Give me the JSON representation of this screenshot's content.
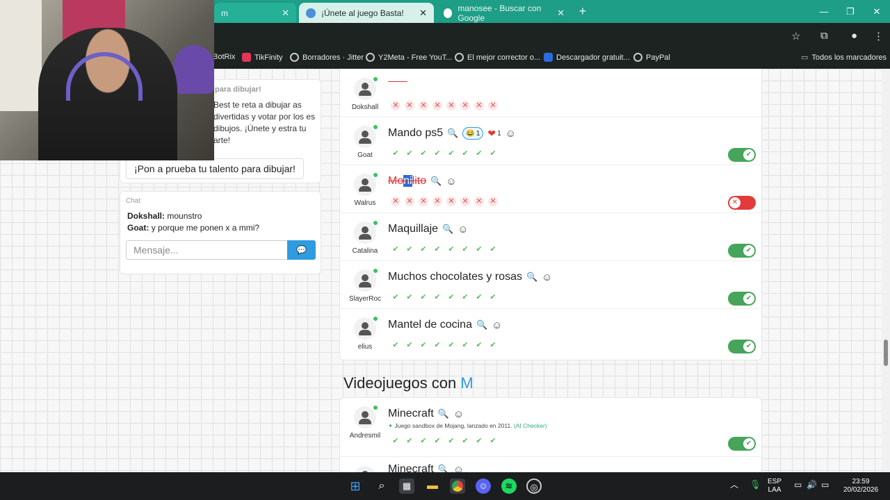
{
  "browser": {
    "tabs": [
      {
        "label": "m",
        "active": false
      },
      {
        "label": "¡Únete al juego Basta!",
        "active": true
      },
      {
        "label": "manosee - Buscar con Google",
        "active": false
      }
    ],
    "bookmarks": [
      "BotRix",
      "TikFinity",
      "Borradores · Jitter",
      "Y2Meta - Free YouT...",
      "El mejor corrector o...",
      "Descargador gratuit...",
      "PayPal"
    ],
    "all_bookmarks": "Todos los marcadores"
  },
  "left": {
    "card_title": "para dibujar!",
    "card_text": "Best te reta a dibujar as divertidas y votar por los es dibujos. ¡Únete y estra tu arte!",
    "card_button": "¡Pon a prueba tu talento para dibujar!",
    "chat_header": "Chat",
    "chat": [
      {
        "user": "Dokshall:",
        "text": "mounstro"
      },
      {
        "user": "Goat:",
        "text": "y porque me ponen x a mmi?"
      }
    ],
    "chat_placeholder": "Mensaje..."
  },
  "rows": [
    {
      "user": "Dokshall",
      "answer": "",
      "marks": "no",
      "toggle": null
    },
    {
      "user": "Goat",
      "answer": "Mando ps5",
      "marks": "ok",
      "toggle": "on",
      "reactions": [
        {
          "emoji": "😂",
          "count": "1"
        },
        {
          "emoji": "❤",
          "count": "1"
        }
      ]
    },
    {
      "user": "Walrus",
      "answer_a": "Mo",
      "answer_hl": "ni",
      "answer_b": "lito",
      "marks": "no",
      "toggle": "off"
    },
    {
      "user": "Catalina",
      "answer": "Maquillaje",
      "marks": "ok",
      "toggle": "on"
    },
    {
      "user": "SlayerRoc",
      "answer": "Muchos chocolates y rosas",
      "marks": "ok",
      "toggle": "on"
    },
    {
      "user": "elius",
      "answer": "Mantel de cocina",
      "marks": "ok",
      "toggle": "on"
    }
  ],
  "section": {
    "title": "Videojuegos con ",
    "letter": "M"
  },
  "section_rows": [
    {
      "user": "Andresmil",
      "answer": "Minecraft",
      "description": "Juego sandbox de Mojang, lanzado en 2011.",
      "ai": "(AI Checker)",
      "marks": "ok",
      "toggle": "on"
    },
    {
      "user": "",
      "answer": "Minecraft"
    }
  ],
  "taskbar": {
    "lang1": "ESP",
    "lang2": "LAA",
    "time": "23:59",
    "date": "20/02/2026"
  },
  "colors": {
    "accent": "#2f9be0",
    "toggle_on": "#46a55a",
    "toggle_off": "#e33a3a",
    "tab_bar": "#1e9e86"
  }
}
